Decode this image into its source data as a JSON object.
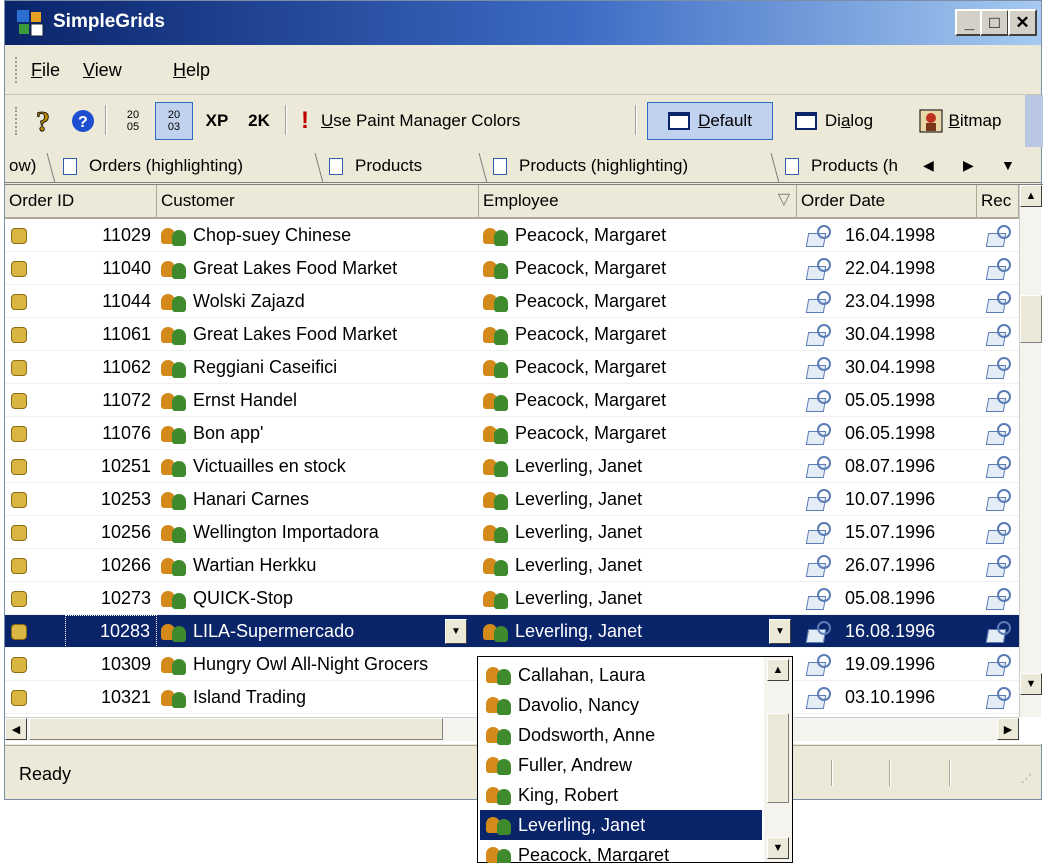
{
  "window": {
    "title": "SimpleGrids",
    "minimize": "_",
    "maximize": "□",
    "close": "✕"
  },
  "menu": [
    {
      "prefix": "",
      "key": "F",
      "rest": "ile"
    },
    {
      "prefix": "",
      "key": "V",
      "rest": "iew"
    },
    {
      "prefix": "",
      "key": "H",
      "rest": "elp"
    }
  ],
  "toolbar": {
    "paint_prefix": "",
    "paint_key": "U",
    "paint_rest": "se Paint Manager Colors",
    "default_key": "D",
    "default_rest": "efault",
    "dialog_prefix": "Di",
    "dialog_key": "a",
    "dialog_rest": "log",
    "bitmap_key": "B",
    "bitmap_rest": "itmap",
    "xp": "XP",
    "k2": "2K",
    "sort1_top": "20",
    "sort1_bot": "05",
    "sort2_top": "20",
    "sort2_bot": "03"
  },
  "tabs": [
    "ow)",
    "Orders (highlighting)",
    "Products",
    "Products (highlighting)",
    "Products (h"
  ],
  "tab_nav": {
    "left": "◀",
    "right": "▶",
    "menu": "▼"
  },
  "columns": [
    "Order ID",
    "Customer",
    "Employee",
    "Order Date",
    "Rec"
  ],
  "rows": [
    {
      "id": "11029",
      "customer": "Chop-suey Chinese",
      "employee": "Peacock, Margaret",
      "date": "16.04.1998"
    },
    {
      "id": "11040",
      "customer": "Great Lakes Food Market",
      "employee": "Peacock, Margaret",
      "date": "22.04.1998"
    },
    {
      "id": "11044",
      "customer": "Wolski Zajazd",
      "employee": "Peacock, Margaret",
      "date": "23.04.1998"
    },
    {
      "id": "11061",
      "customer": "Great Lakes Food Market",
      "employee": "Peacock, Margaret",
      "date": "30.04.1998"
    },
    {
      "id": "11062",
      "customer": "Reggiani Caseifici",
      "employee": "Peacock, Margaret",
      "date": "30.04.1998"
    },
    {
      "id": "11072",
      "customer": "Ernst Handel",
      "employee": "Peacock, Margaret",
      "date": "05.05.1998"
    },
    {
      "id": "11076",
      "customer": "Bon app'",
      "employee": "Peacock, Margaret",
      "date": "06.05.1998"
    },
    {
      "id": "10251",
      "customer": "Victuailles en stock",
      "employee": "Leverling, Janet",
      "date": "08.07.1996"
    },
    {
      "id": "10253",
      "customer": "Hanari Carnes",
      "employee": "Leverling, Janet",
      "date": "10.07.1996"
    },
    {
      "id": "10256",
      "customer": "Wellington Importadora",
      "employee": "Leverling, Janet",
      "date": "15.07.1996"
    },
    {
      "id": "10266",
      "customer": "Wartian Herkku",
      "employee": "Leverling, Janet",
      "date": "26.07.1996"
    },
    {
      "id": "10273",
      "customer": "QUICK-Stop",
      "employee": "Leverling, Janet",
      "date": "05.08.1996"
    },
    {
      "id": "10283",
      "customer": "LILA-Supermercado",
      "employee": "Leverling, Janet",
      "date": "16.08.1996",
      "selected": true
    },
    {
      "id": "10309",
      "customer": "Hungry Owl All-Night Grocers",
      "employee": "",
      "date": "19.09.1996"
    },
    {
      "id": "10321",
      "customer": "Island Trading",
      "employee": "",
      "date": "03.10.1996"
    }
  ],
  "dropdown": {
    "items": [
      "Callahan, Laura",
      "Davolio, Nancy",
      "Dodsworth, Anne",
      "Fuller, Andrew",
      "King, Robert",
      "Leverling, Janet",
      "Peacock, Margaret"
    ],
    "selected_index": 5
  },
  "status": {
    "text": "Ready"
  },
  "colors": {
    "selection": "#0a246a",
    "face": "#ece9d8"
  }
}
